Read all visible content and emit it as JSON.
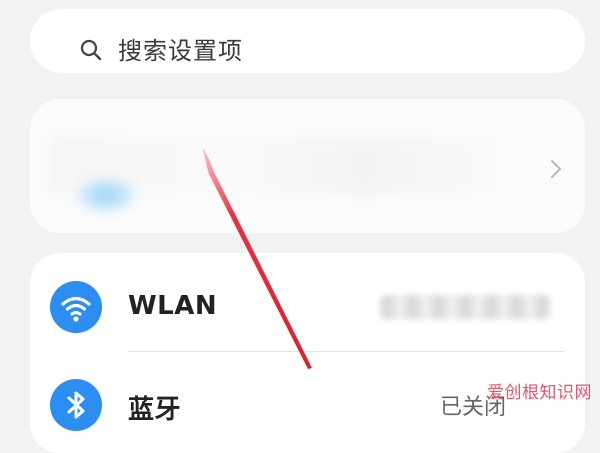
{
  "search": {
    "placeholder": "搜索设置项"
  },
  "account": {},
  "list": {
    "wlan": {
      "label": "WLAN"
    },
    "bluetooth": {
      "label": "蓝牙",
      "status": "已关闭"
    }
  },
  "colors": {
    "accent": "#2b8ef0",
    "annotation": "#e8323c"
  },
  "watermark": {
    "text": "爱创根知识网"
  }
}
